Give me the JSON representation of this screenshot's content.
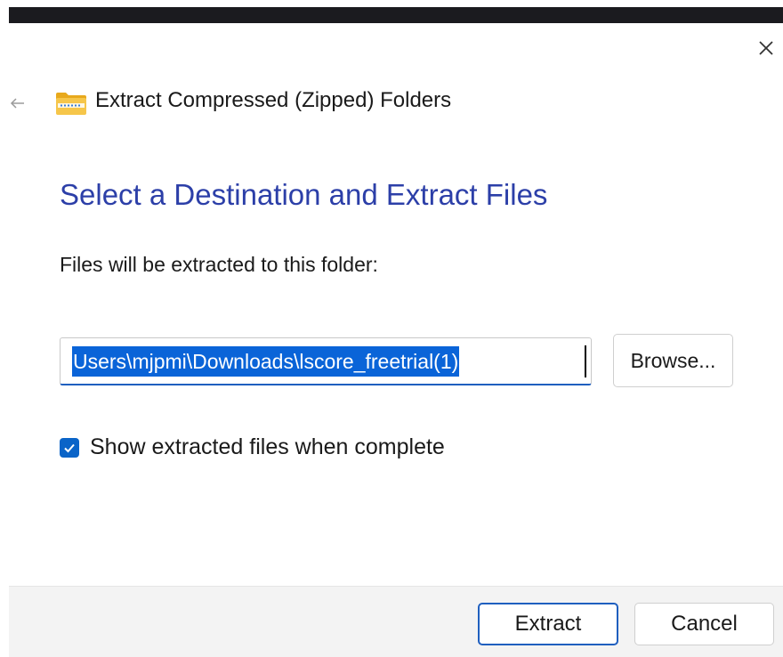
{
  "window": {
    "title": "Extract Compressed (Zipped) Folders"
  },
  "main": {
    "heading": "Select a Destination and Extract Files",
    "instruction": "Files will be extracted to this folder:",
    "path_value": "Users\\mjpmi\\Downloads\\lscore_freetrial(1)",
    "browse_label": "Browse...",
    "show_files_label": "Show extracted files when complete",
    "show_files_checked": true
  },
  "footer": {
    "extract_label": "Extract",
    "cancel_label": "Cancel"
  },
  "icons": {
    "close": "close-icon",
    "back": "back-arrow-icon",
    "app": "zipped-folder-icon",
    "check": "checkmark-icon"
  },
  "colors": {
    "heading": "#2c3fa8",
    "accent": "#1f5fbf",
    "selection": "#0a64d8",
    "footer_bg": "#f3f3f3"
  }
}
